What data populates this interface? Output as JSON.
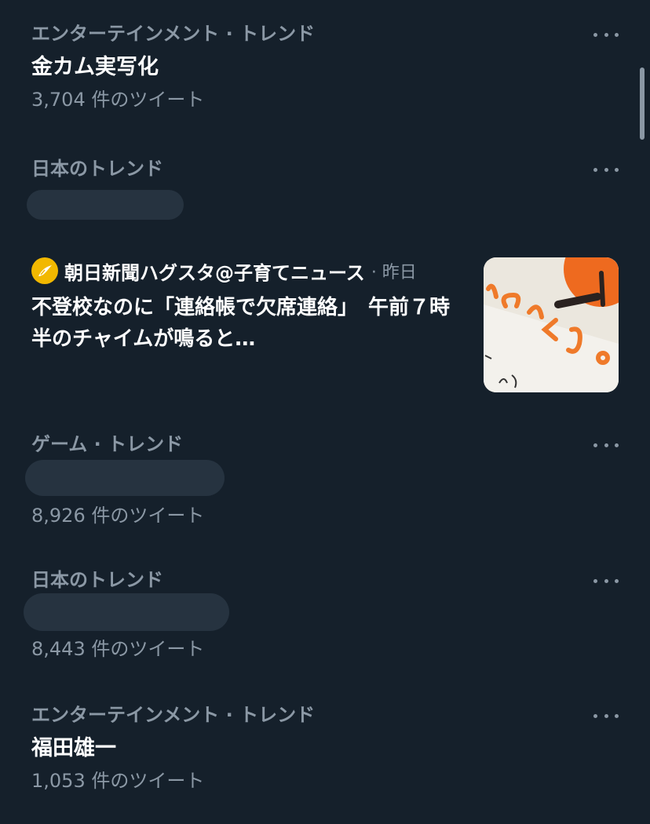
{
  "trends": [
    {
      "meta": "エンターテインメント · トレンド",
      "title": "金カム実写化",
      "count": "3,704 件のツイート"
    },
    {
      "meta": "日本のトレンド"
    },
    {
      "meta": "ゲーム · トレンド",
      "count": "8,926 件のツイート"
    },
    {
      "meta": "日本のトレンド",
      "count": "8,443 件のツイート"
    },
    {
      "meta": "エンターテインメント · トレンド",
      "title": "福田雄一",
      "count": "1,053 件のツイート"
    }
  ],
  "news": {
    "source": "朝日新聞ハグスタ@子育てニュース",
    "time": "· 昨日",
    "title": "不登校なのに「連絡帳で欠席連絡」　午前７時半のチャイムが鳴ると…",
    "logo_icon": "bird-icon",
    "logo_color": "#f2b800"
  },
  "icons": {
    "more": "more-horizontal-icon"
  },
  "colors": {
    "background": "#15202b",
    "secondary_text": "#8b98a5",
    "redaction": "#263340"
  }
}
